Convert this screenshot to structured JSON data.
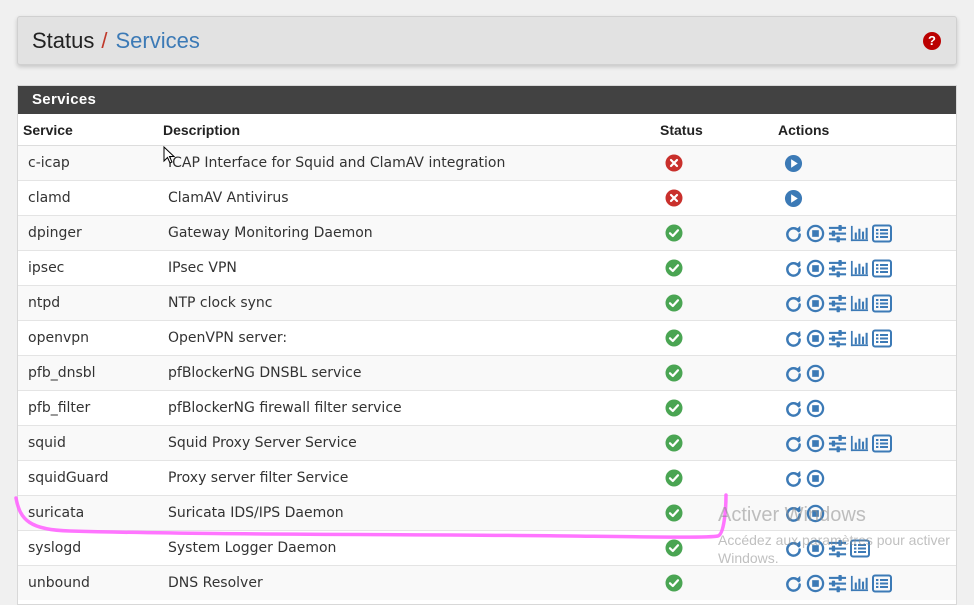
{
  "breadcrumb": {
    "root": "Status",
    "separator": "/",
    "current": "Services"
  },
  "help_icon": "question-circle-icon",
  "panel": {
    "title": "Services"
  },
  "table": {
    "headers": [
      "Service",
      "Description",
      "Status",
      "Actions"
    ],
    "rows": [
      {
        "service": "c-icap",
        "description": "ICAP Interface for Squid and ClamAV integration",
        "status": "stopped",
        "actions": [
          "start"
        ]
      },
      {
        "service": "clamd",
        "description": "ClamAV Antivirus",
        "status": "stopped",
        "actions": [
          "start"
        ]
      },
      {
        "service": "dpinger",
        "description": "Gateway Monitoring Daemon",
        "status": "running",
        "actions": [
          "restart",
          "stop",
          "settings",
          "status",
          "logs"
        ]
      },
      {
        "service": "ipsec",
        "description": "IPsec VPN",
        "status": "running",
        "actions": [
          "restart",
          "stop",
          "settings",
          "status",
          "logs"
        ]
      },
      {
        "service": "ntpd",
        "description": "NTP clock sync",
        "status": "running",
        "actions": [
          "restart",
          "stop",
          "settings",
          "status",
          "logs"
        ]
      },
      {
        "service": "openvpn",
        "description": "OpenVPN server:",
        "status": "running",
        "actions": [
          "restart",
          "stop",
          "settings",
          "status",
          "logs"
        ]
      },
      {
        "service": "pfb_dnsbl",
        "description": "pfBlockerNG DNSBL service",
        "status": "running",
        "actions": [
          "restart",
          "stop"
        ]
      },
      {
        "service": "pfb_filter",
        "description": "pfBlockerNG firewall filter service",
        "status": "running",
        "actions": [
          "restart",
          "stop"
        ]
      },
      {
        "service": "squid",
        "description": "Squid Proxy Server Service",
        "status": "running",
        "actions": [
          "restart",
          "stop",
          "settings",
          "status",
          "logs"
        ]
      },
      {
        "service": "squidGuard",
        "description": "Proxy server filter Service",
        "status": "running",
        "actions": [
          "restart",
          "stop"
        ]
      },
      {
        "service": "suricata",
        "description": "Suricata IDS/IPS Daemon",
        "status": "running",
        "actions": [
          "restart",
          "stop"
        ]
      },
      {
        "service": "syslogd",
        "description": "System Logger Daemon",
        "status": "running",
        "actions": [
          "restart",
          "stop",
          "settings",
          "logs"
        ]
      },
      {
        "service": "unbound",
        "description": "DNS Resolver",
        "status": "running",
        "actions": [
          "restart",
          "stop",
          "settings",
          "status",
          "logs"
        ]
      }
    ]
  },
  "watermark": {
    "title": "Activer Windows",
    "subtitle": "Accédez aux paramètres pour activer Windows."
  },
  "colors": {
    "link": "#3c7ab6",
    "running": "#4aa553",
    "stopped": "#c9302c",
    "header": "#424242",
    "highlight": "#ff66ff"
  }
}
